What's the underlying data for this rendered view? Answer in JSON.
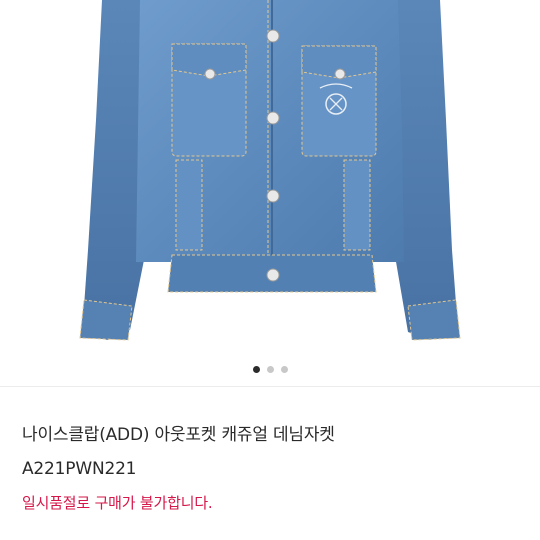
{
  "product": {
    "title_line1": "나이스클랍(ADD) 아웃포켓 캐쥬얼 데님자켓",
    "title_line2": "A221PWN221",
    "status_text": "일시품절로 구매가 불가합니다.",
    "status_color": "#d6174a"
  },
  "gallery": {
    "image_subject": "denim-jacket",
    "dot_count": 3,
    "active_index": 0
  }
}
